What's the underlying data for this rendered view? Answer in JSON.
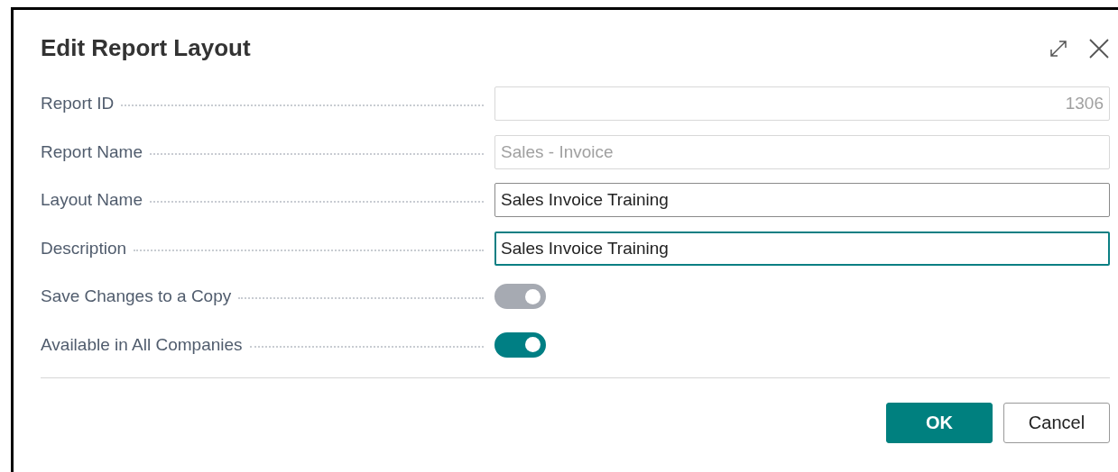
{
  "dialog": {
    "title": "Edit Report Layout"
  },
  "fields": [
    {
      "kind": "number",
      "label": "Report ID",
      "value": "1306",
      "disabled": true,
      "focused": false
    },
    {
      "kind": "text",
      "label": "Report Name",
      "value": "Sales - Invoice",
      "disabled": true,
      "focused": false
    },
    {
      "kind": "text",
      "label": "Layout Name",
      "value": "Sales Invoice Training",
      "disabled": false,
      "focused": false
    },
    {
      "kind": "text",
      "label": "Description",
      "value": "Sales Invoice Training",
      "disabled": false,
      "focused": true
    },
    {
      "kind": "toggle",
      "label": "Save Changes to a Copy",
      "on": true,
      "disabled": true
    },
    {
      "kind": "toggle",
      "label": "Available in All Companies",
      "on": true,
      "disabled": false
    }
  ],
  "buttons": [
    {
      "label": "OK",
      "primary": true
    },
    {
      "label": "Cancel",
      "primary": false
    }
  ]
}
